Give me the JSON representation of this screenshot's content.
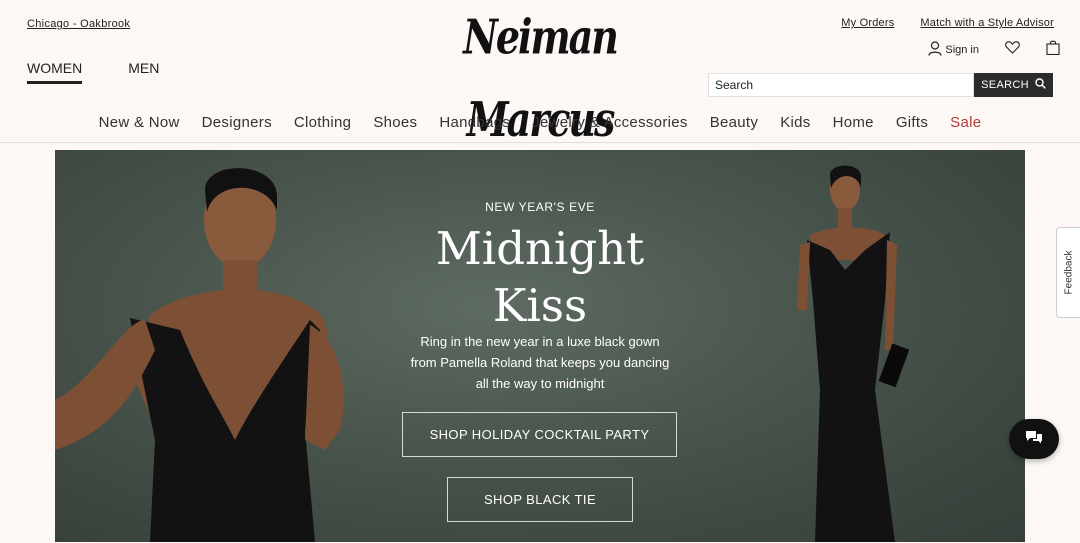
{
  "header": {
    "store_location": "Chicago - Oakbrook",
    "logo_text": "NeimanMarcus",
    "gender_tabs": [
      {
        "label": "WOMEN",
        "active": true
      },
      {
        "label": "MEN",
        "active": false
      }
    ],
    "top_links": [
      "My Orders",
      "Match with a Style Advisor"
    ],
    "sign_in_label": "Sign in",
    "search": {
      "placeholder": "Search",
      "button_label": "SEARCH"
    }
  },
  "nav": {
    "items": [
      "New & Now",
      "Designers",
      "Clothing",
      "Shoes",
      "Handbags",
      "Jewelry & Accessories",
      "Beauty",
      "Kids",
      "Home",
      "Gifts",
      "Sale"
    ]
  },
  "hero": {
    "eyebrow": "NEW YEAR'S EVE",
    "headline_line1": "Midnight",
    "headline_line2": "Kiss",
    "description_line1": "Ring in the new year in a luxe black gown",
    "description_line2": "from Pamella Roland that keeps you dancing",
    "description_line3": "all the way to midnight",
    "cta_primary": "SHOP HOLIDAY COCKTAIL PARTY",
    "cta_secondary": "SHOP BLACK TIE"
  },
  "widgets": {
    "feedback_label": "Feedback"
  },
  "colors": {
    "sale": "#b23a3a",
    "background": "#fdf8f5",
    "hero_bg": "#48544c",
    "search_button": "#2b2b2b"
  },
  "icons": [
    "user-icon",
    "heart-icon",
    "shopping-bag-icon",
    "search-icon",
    "chat-icon"
  ]
}
